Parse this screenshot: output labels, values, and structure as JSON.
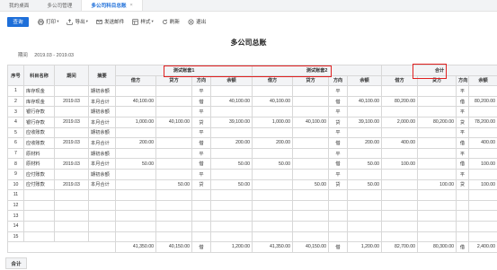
{
  "tabs": [
    {
      "label": "我的桌面",
      "active": false
    },
    {
      "label": "多公司管理",
      "active": false
    },
    {
      "label": "多公司科目总账",
      "active": true,
      "closable": true
    }
  ],
  "toolbar": {
    "query_label": "查询",
    "tools": [
      {
        "label": "打印",
        "icon": "printer-icon",
        "dropdown": true
      },
      {
        "label": "导出",
        "icon": "export-icon",
        "dropdown": true
      },
      {
        "label": "发送邮件",
        "icon": "mail-icon",
        "dropdown": false
      },
      {
        "label": "样式",
        "icon": "style-icon",
        "dropdown": true
      },
      {
        "label": "刷新",
        "icon": "refresh-icon",
        "dropdown": false
      },
      {
        "label": "退出",
        "icon": "exit-icon",
        "dropdown": false
      }
    ]
  },
  "report": {
    "title": "多公司总账",
    "period_label": "期间",
    "period_value": "2019.03 - 2019.03"
  },
  "table": {
    "header_groups": [
      "测试账套1",
      "测试账套2",
      "合计"
    ],
    "fixed_headers": [
      "序号",
      "科目名称",
      "期间",
      "摘要"
    ],
    "sub_headers": [
      "借方",
      "贷方",
      "方向",
      "余额"
    ],
    "rows": [
      {
        "no": "1",
        "subject": "库存现金",
        "period": "",
        "summary": "期初余额",
        "cells": [
          "",
          "",
          "平",
          "",
          "",
          "",
          "平",
          "",
          "",
          "",
          "平",
          ""
        ]
      },
      {
        "no": "2",
        "subject": "库存现金",
        "period": "2019.03",
        "summary": "本月合计",
        "cells": [
          "40,100.00",
          "",
          "借",
          "40,100.00",
          "40,100.00",
          "",
          "借",
          "40,100.00",
          "80,200.00",
          "",
          "借",
          "80,200.00"
        ]
      },
      {
        "no": "3",
        "subject": "银行存款",
        "period": "",
        "summary": "期初余额",
        "cells": [
          "",
          "",
          "平",
          "",
          "",
          "",
          "平",
          "",
          "",
          "",
          "平",
          ""
        ]
      },
      {
        "no": "4",
        "subject": "银行存款",
        "period": "2019.03",
        "summary": "本月合计",
        "cells": [
          "1,000.00",
          "40,100.00",
          "贷",
          "39,100.00",
          "1,000.00",
          "40,100.00",
          "贷",
          "39,100.00",
          "2,000.00",
          "80,200.00",
          "贷",
          "78,200.00"
        ]
      },
      {
        "no": "5",
        "subject": "应收账款",
        "period": "",
        "summary": "期初余额",
        "cells": [
          "",
          "",
          "平",
          "",
          "",
          "",
          "平",
          "",
          "",
          "",
          "平",
          ""
        ]
      },
      {
        "no": "6",
        "subject": "应收账款",
        "period": "2019.03",
        "summary": "本月合计",
        "cells": [
          "200.00",
          "",
          "借",
          "200.00",
          "200.00",
          "",
          "借",
          "200.00",
          "400.00",
          "",
          "借",
          "400.00"
        ]
      },
      {
        "no": "7",
        "subject": "原材料",
        "period": "",
        "summary": "期初余额",
        "cells": [
          "",
          "",
          "平",
          "",
          "",
          "",
          "平",
          "",
          "",
          "",
          "平",
          ""
        ]
      },
      {
        "no": "8",
        "subject": "原材料",
        "period": "2019.03",
        "summary": "本月合计",
        "cells": [
          "50.00",
          "",
          "借",
          "50.00",
          "50.00",
          "",
          "借",
          "50.00",
          "100.00",
          "",
          "借",
          "100.00"
        ]
      },
      {
        "no": "9",
        "subject": "应付账款",
        "period": "",
        "summary": "期初余额",
        "cells": [
          "",
          "",
          "平",
          "",
          "",
          "",
          "平",
          "",
          "",
          "",
          "平",
          ""
        ]
      },
      {
        "no": "10",
        "subject": "应付账款",
        "period": "2019.03",
        "summary": "本月合计",
        "cells": [
          "",
          "50.00",
          "贷",
          "50.00",
          "",
          "50.00",
          "贷",
          "50.00",
          "",
          "100.00",
          "贷",
          "100.00"
        ]
      },
      {
        "no": "11",
        "subject": "",
        "period": "",
        "summary": "",
        "cells": [
          "",
          "",
          "",
          "",
          "",
          "",
          "",
          "",
          "",
          "",
          "",
          ""
        ]
      },
      {
        "no": "12",
        "subject": "",
        "period": "",
        "summary": "",
        "cells": [
          "",
          "",
          "",
          "",
          "",
          "",
          "",
          "",
          "",
          "",
          "",
          ""
        ]
      },
      {
        "no": "13",
        "subject": "",
        "period": "",
        "summary": "",
        "cells": [
          "",
          "",
          "",
          "",
          "",
          "",
          "",
          "",
          "",
          "",
          "",
          ""
        ]
      },
      {
        "no": "14",
        "subject": "",
        "period": "",
        "summary": "",
        "cells": [
          "",
          "",
          "",
          "",
          "",
          "",
          "",
          "",
          "",
          "",
          "",
          ""
        ]
      },
      {
        "no": "15",
        "subject": "",
        "period": "",
        "summary": "",
        "cells": [
          "",
          "",
          "",
          "",
          "",
          "",
          "",
          "",
          "",
          "",
          "",
          ""
        ]
      }
    ],
    "total_label": "合计",
    "totals": [
      "41,350.00",
      "40,150.00",
      "借",
      "1,200.00",
      "41,350.00",
      "40,150.00",
      "借",
      "1,200.00",
      "82,700.00",
      "80,300.00",
      "借",
      "2,400.00"
    ]
  },
  "colors": {
    "accent": "#1e6fd9",
    "highlight": "#e02020"
  }
}
